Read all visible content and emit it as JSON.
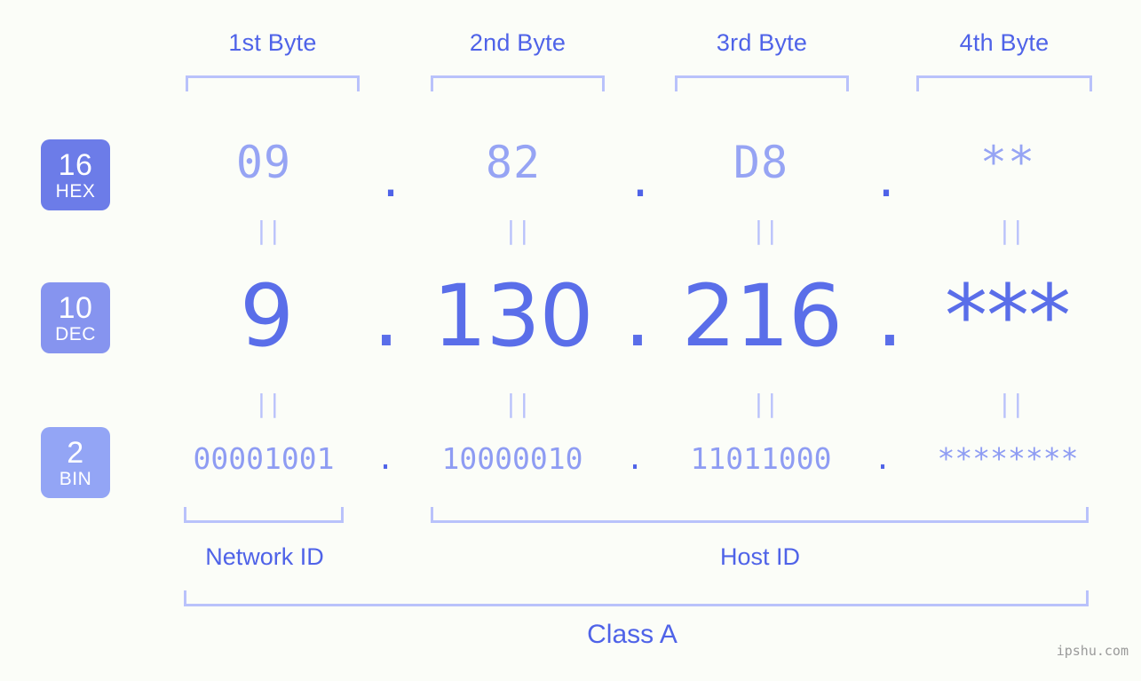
{
  "background_color": "#fbfdf8",
  "accent_color": "#4f63e8",
  "muted_accent_color": "#b9c2fb",
  "byte_headers": [
    {
      "label": "1st Byte"
    },
    {
      "label": "2nd Byte"
    },
    {
      "label": "3rd Byte"
    },
    {
      "label": "4th Byte"
    }
  ],
  "rows": {
    "hex": {
      "base": "16",
      "abbr": "HEX",
      "badge_color": "#6c7ce8",
      "values": [
        "09",
        "82",
        "D8",
        "**"
      ],
      "separators": [
        ".",
        ".",
        "."
      ]
    },
    "dec": {
      "base": "10",
      "abbr": "DEC",
      "badge_color": "#8694ef",
      "values": [
        "9",
        "130",
        "216",
        "***"
      ],
      "separators": [
        ".",
        ".",
        "."
      ]
    },
    "bin": {
      "base": "2",
      "abbr": "BIN",
      "badge_color": "#93a5f5",
      "values": [
        "00001001",
        "10000010",
        "11011000",
        "********"
      ],
      "separators": [
        ".",
        ".",
        "."
      ]
    }
  },
  "equals_marks": {
    "glyph": "||",
    "count_per_row": 4
  },
  "segments": {
    "network_id": "Network ID",
    "host_id": "Host ID"
  },
  "class_label": "Class A",
  "watermark": "ipshu.com"
}
